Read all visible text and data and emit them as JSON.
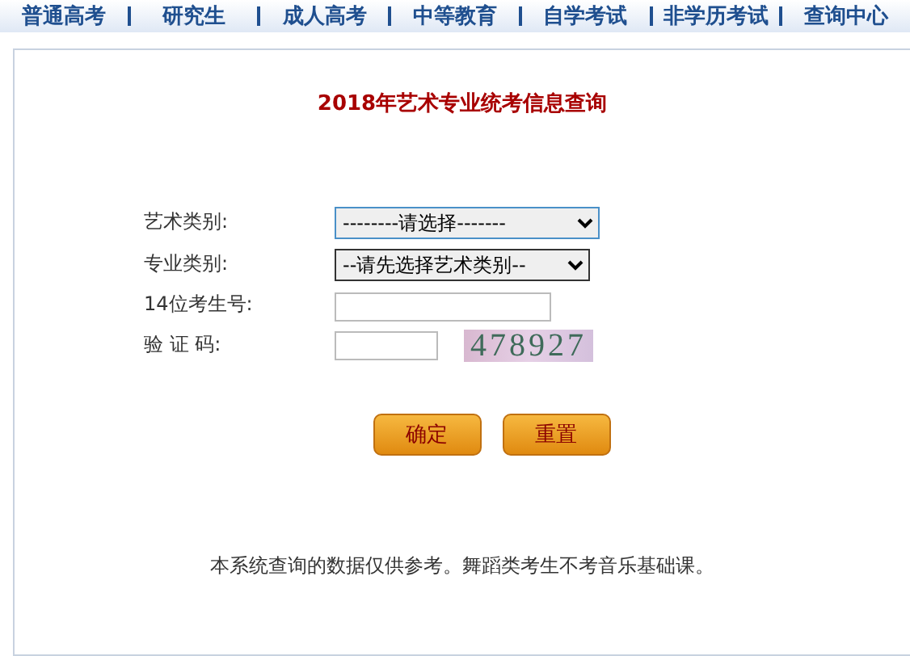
{
  "nav": [
    {
      "label": "普通高考"
    },
    {
      "label": "研究生"
    },
    {
      "label": "成人高考"
    },
    {
      "label": "中等教育"
    },
    {
      "label": "自学考试"
    },
    {
      "label": "非学历考试"
    },
    {
      "label": "查询中心"
    }
  ],
  "title": "2018年艺术专业统考信息查询",
  "form": [
    {
      "kind": "select",
      "label": "艺术类别:",
      "value": "--------请选择-------",
      "focused": true
    },
    {
      "kind": "select",
      "label": "专业类别:",
      "value": "--请先选择艺术类别--",
      "focused": false
    },
    {
      "kind": "input",
      "label": "14位考生号:"
    },
    {
      "kind": "captcha",
      "label": "验 证 码:",
      "code": "478927"
    }
  ],
  "buttons": [
    {
      "label": "确定"
    },
    {
      "label": "重置"
    }
  ],
  "note": "本系统查询的数据仅供参考。舞蹈类考生不考音乐基础课。"
}
